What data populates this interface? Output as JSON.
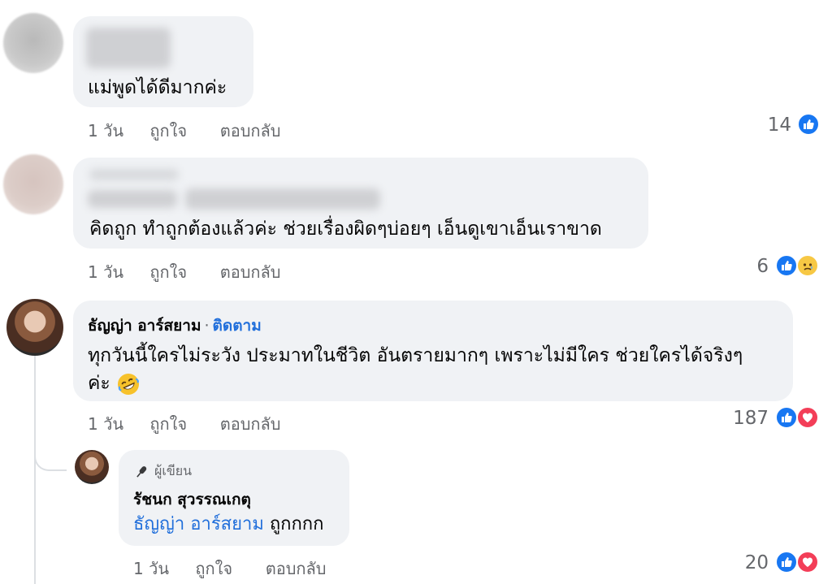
{
  "comments": [
    {
      "text": "แม่พูดได้ดีมากค่ะ",
      "time": "1 วัน",
      "like_label": "ถูกใจ",
      "reply_label": "ตอบกลับ",
      "reaction_count": "14",
      "reactions": [
        "like-icon"
      ]
    },
    {
      "text": "คิดถูก ทำถูกต้องแล้วค่ะ ช่วยเรื่องผิดๆบ่อยๆ เอ็นดูเขาเอ็นเราขาด",
      "time": "1 วัน",
      "like_label": "ถูกใจ",
      "reply_label": "ตอบกลับ",
      "reaction_count": "6",
      "reactions": [
        "like-icon",
        "sad-icon"
      ]
    },
    {
      "author": "ธัญญ่า อาร์สยาม",
      "separator": "·",
      "follow_label": "ติดตาม",
      "text_line1": "ทุกวันนี้ใครไม่ระวัง ประมาทในชีวิต อันตรายมากๆ เพราะไม่มีใคร ช่วยใครได้จริงๆ",
      "text_line2": "ค่ะ",
      "emoji": "rolling-laughing-emoji",
      "time": "1 วัน",
      "like_label": "ถูกใจ",
      "reply_label": "ตอบกลับ",
      "reaction_count": "187",
      "reactions": [
        "like-icon",
        "heart-icon"
      ]
    }
  ],
  "reply": {
    "badge_label": "ผู้เขียน",
    "author": "รัชนก สุวรรณเกตุ",
    "mention": "ธัญญ่า อาร์สยาม",
    "text": "ถูกกกก",
    "time": "1 วัน",
    "like_label": "ถูกใจ",
    "reply_label": "ตอบกลับ",
    "reaction_count": "20",
    "reactions": [
      "like-icon",
      "heart-icon"
    ]
  },
  "colors": {
    "link_blue": "#216fdb",
    "bubble_bg": "#f0f2f5",
    "meta_gray": "#65676b",
    "like_blue": "#1877f2",
    "heart_red": "#f33e58"
  }
}
